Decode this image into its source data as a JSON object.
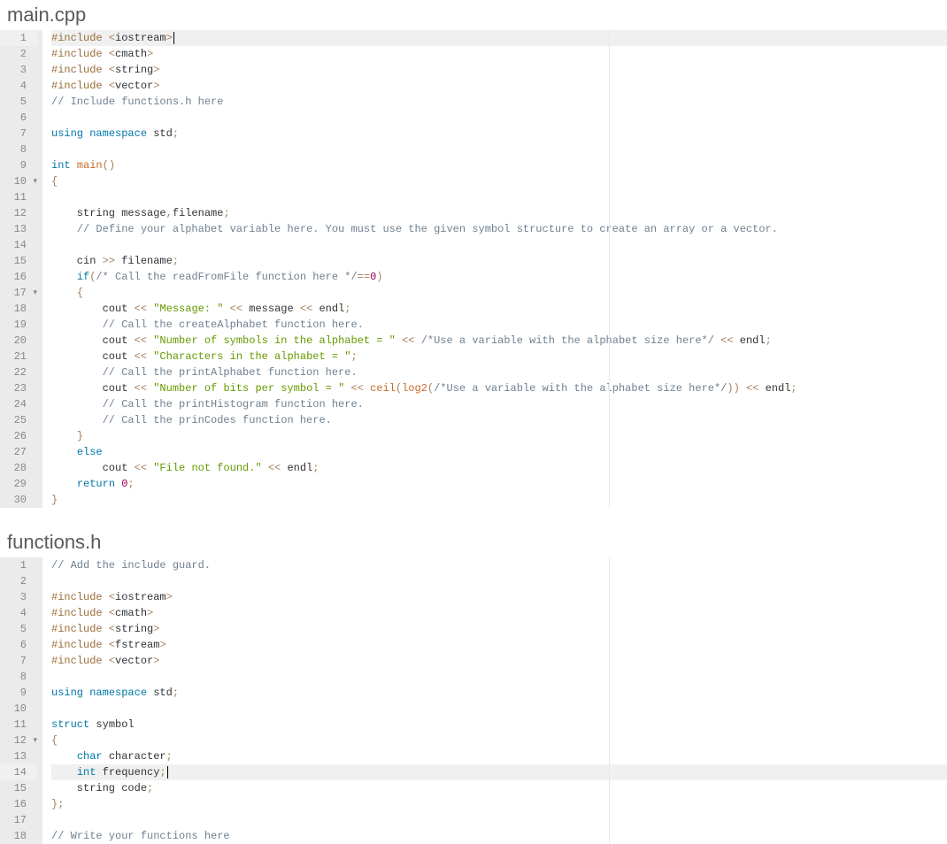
{
  "files": [
    {
      "title": "main.cpp",
      "highlight": 1,
      "cursor_line": 1,
      "lines": [
        {
          "n": 1,
          "fold": "",
          "tokens": [
            [
              "pre",
              "#include "
            ],
            [
              "op",
              "<"
            ],
            [
              "id",
              "iostream"
            ],
            [
              "op",
              ">"
            ]
          ]
        },
        {
          "n": 2,
          "fold": "",
          "tokens": [
            [
              "pre",
              "#include "
            ],
            [
              "op",
              "<"
            ],
            [
              "id",
              "cmath"
            ],
            [
              "op",
              ">"
            ]
          ]
        },
        {
          "n": 3,
          "fold": "",
          "tokens": [
            [
              "pre",
              "#include "
            ],
            [
              "op",
              "<"
            ],
            [
              "id",
              "string"
            ],
            [
              "op",
              ">"
            ]
          ]
        },
        {
          "n": 4,
          "fold": "",
          "tokens": [
            [
              "pre",
              "#include "
            ],
            [
              "op",
              "<"
            ],
            [
              "id",
              "vector"
            ],
            [
              "op",
              ">"
            ]
          ]
        },
        {
          "n": 5,
          "fold": "",
          "tokens": [
            [
              "cmt",
              "// Include functions.h here"
            ]
          ]
        },
        {
          "n": 6,
          "fold": "",
          "tokens": []
        },
        {
          "n": 7,
          "fold": "",
          "tokens": [
            [
              "kw",
              "using"
            ],
            [
              "id",
              " "
            ],
            [
              "kw",
              "namespace"
            ],
            [
              "id",
              " std"
            ],
            [
              "op",
              ";"
            ]
          ]
        },
        {
          "n": 8,
          "fold": "",
          "tokens": []
        },
        {
          "n": 9,
          "fold": "",
          "tokens": [
            [
              "type",
              "int"
            ],
            [
              "id",
              " "
            ],
            [
              "fn",
              "main"
            ],
            [
              "op",
              "()"
            ]
          ]
        },
        {
          "n": 10,
          "fold": "▾",
          "tokens": [
            [
              "op",
              "{"
            ]
          ]
        },
        {
          "n": 11,
          "fold": "",
          "tokens": []
        },
        {
          "n": 12,
          "fold": "",
          "tokens": [
            [
              "id",
              "    string message"
            ],
            [
              "op",
              ","
            ],
            [
              "id",
              "filename"
            ],
            [
              "op",
              ";"
            ]
          ]
        },
        {
          "n": 13,
          "fold": "",
          "tokens": [
            [
              "id",
              "    "
            ],
            [
              "cmt",
              "// Define your alphabet variable here. You must use the given symbol structure to create an array or a vector."
            ]
          ]
        },
        {
          "n": 14,
          "fold": "",
          "tokens": []
        },
        {
          "n": 15,
          "fold": "",
          "tokens": [
            [
              "id",
              "    cin "
            ],
            [
              "op",
              ">>"
            ],
            [
              "id",
              " filename"
            ],
            [
              "op",
              ";"
            ]
          ]
        },
        {
          "n": 16,
          "fold": "",
          "tokens": [
            [
              "id",
              "    "
            ],
            [
              "kw",
              "if"
            ],
            [
              "op",
              "("
            ],
            [
              "cmt",
              "/* Call the readFromFile function here */"
            ],
            [
              "op",
              "=="
            ],
            [
              "num",
              "0"
            ],
            [
              "op",
              ")"
            ]
          ]
        },
        {
          "n": 17,
          "fold": "▾",
          "tokens": [
            [
              "id",
              "    "
            ],
            [
              "op",
              "{"
            ]
          ]
        },
        {
          "n": 18,
          "fold": "",
          "tokens": [
            [
              "id",
              "        cout "
            ],
            [
              "op",
              "<<"
            ],
            [
              "id",
              " "
            ],
            [
              "str",
              "\"Message: \""
            ],
            [
              "id",
              " "
            ],
            [
              "op",
              "<<"
            ],
            [
              "id",
              " message "
            ],
            [
              "op",
              "<<"
            ],
            [
              "id",
              " endl"
            ],
            [
              "op",
              ";"
            ]
          ]
        },
        {
          "n": 19,
          "fold": "",
          "tokens": [
            [
              "id",
              "        "
            ],
            [
              "cmt",
              "// Call the createAlphabet function here."
            ]
          ]
        },
        {
          "n": 20,
          "fold": "",
          "tokens": [
            [
              "id",
              "        cout "
            ],
            [
              "op",
              "<<"
            ],
            [
              "id",
              " "
            ],
            [
              "str",
              "\"Number of symbols in the alphabet = \""
            ],
            [
              "id",
              " "
            ],
            [
              "op",
              "<<"
            ],
            [
              "id",
              " "
            ],
            [
              "cmt",
              "/*Use a variable with the alphabet size here*/"
            ],
            [
              "id",
              " "
            ],
            [
              "op",
              "<<"
            ],
            [
              "id",
              " endl"
            ],
            [
              "op",
              ";"
            ]
          ]
        },
        {
          "n": 21,
          "fold": "",
          "tokens": [
            [
              "id",
              "        cout "
            ],
            [
              "op",
              "<<"
            ],
            [
              "id",
              " "
            ],
            [
              "str",
              "\"Characters in the alphabet = \""
            ],
            [
              "op",
              ";"
            ]
          ]
        },
        {
          "n": 22,
          "fold": "",
          "tokens": [
            [
              "id",
              "        "
            ],
            [
              "cmt",
              "// Call the printAlphabet function here."
            ]
          ]
        },
        {
          "n": 23,
          "fold": "",
          "tokens": [
            [
              "id",
              "        cout "
            ],
            [
              "op",
              "<<"
            ],
            [
              "id",
              " "
            ],
            [
              "str",
              "\"Number of bits per symbol = \""
            ],
            [
              "id",
              " "
            ],
            [
              "op",
              "<<"
            ],
            [
              "id",
              " "
            ],
            [
              "fn",
              "ceil"
            ],
            [
              "op",
              "("
            ],
            [
              "fn",
              "log2"
            ],
            [
              "op",
              "("
            ],
            [
              "cmt",
              "/*Use a variable with the alphabet size here*/"
            ],
            [
              "op",
              "))"
            ],
            [
              "id",
              " "
            ],
            [
              "op",
              "<<"
            ],
            [
              "id",
              " endl"
            ],
            [
              "op",
              ";"
            ]
          ]
        },
        {
          "n": 24,
          "fold": "",
          "tokens": [
            [
              "id",
              "        "
            ],
            [
              "cmt",
              "// Call the printHistogram function here."
            ]
          ]
        },
        {
          "n": 25,
          "fold": "",
          "tokens": [
            [
              "id",
              "        "
            ],
            [
              "cmt",
              "// Call the prinCodes function here."
            ]
          ]
        },
        {
          "n": 26,
          "fold": "",
          "tokens": [
            [
              "id",
              "    "
            ],
            [
              "op",
              "}"
            ]
          ]
        },
        {
          "n": 27,
          "fold": "",
          "tokens": [
            [
              "id",
              "    "
            ],
            [
              "kw",
              "else"
            ]
          ]
        },
        {
          "n": 28,
          "fold": "",
          "tokens": [
            [
              "id",
              "        cout "
            ],
            [
              "op",
              "<<"
            ],
            [
              "id",
              " "
            ],
            [
              "str",
              "\"File not found.\""
            ],
            [
              "id",
              " "
            ],
            [
              "op",
              "<<"
            ],
            [
              "id",
              " endl"
            ],
            [
              "op",
              ";"
            ]
          ]
        },
        {
          "n": 29,
          "fold": "",
          "tokens": [
            [
              "id",
              "    "
            ],
            [
              "kw",
              "return"
            ],
            [
              "id",
              " "
            ],
            [
              "num",
              "0"
            ],
            [
              "op",
              ";"
            ]
          ]
        },
        {
          "n": 30,
          "fold": "",
          "tokens": [
            [
              "op",
              "}"
            ]
          ]
        }
      ]
    },
    {
      "title": "functions.h",
      "highlight": 14,
      "cursor_line": 14,
      "lines": [
        {
          "n": 1,
          "fold": "",
          "tokens": [
            [
              "cmt",
              "// Add the include guard."
            ]
          ]
        },
        {
          "n": 2,
          "fold": "",
          "tokens": []
        },
        {
          "n": 3,
          "fold": "",
          "tokens": [
            [
              "pre",
              "#include "
            ],
            [
              "op",
              "<"
            ],
            [
              "id",
              "iostream"
            ],
            [
              "op",
              ">"
            ]
          ]
        },
        {
          "n": 4,
          "fold": "",
          "tokens": [
            [
              "pre",
              "#include "
            ],
            [
              "op",
              "<"
            ],
            [
              "id",
              "cmath"
            ],
            [
              "op",
              ">"
            ]
          ]
        },
        {
          "n": 5,
          "fold": "",
          "tokens": [
            [
              "pre",
              "#include "
            ],
            [
              "op",
              "<"
            ],
            [
              "id",
              "string"
            ],
            [
              "op",
              ">"
            ]
          ]
        },
        {
          "n": 6,
          "fold": "",
          "tokens": [
            [
              "pre",
              "#include "
            ],
            [
              "op",
              "<"
            ],
            [
              "id",
              "fstream"
            ],
            [
              "op",
              ">"
            ]
          ]
        },
        {
          "n": 7,
          "fold": "",
          "tokens": [
            [
              "pre",
              "#include "
            ],
            [
              "op",
              "<"
            ],
            [
              "id",
              "vector"
            ],
            [
              "op",
              ">"
            ]
          ]
        },
        {
          "n": 8,
          "fold": "",
          "tokens": []
        },
        {
          "n": 9,
          "fold": "",
          "tokens": [
            [
              "kw",
              "using"
            ],
            [
              "id",
              " "
            ],
            [
              "kw",
              "namespace"
            ],
            [
              "id",
              " std"
            ],
            [
              "op",
              ";"
            ]
          ]
        },
        {
          "n": 10,
          "fold": "",
          "tokens": []
        },
        {
          "n": 11,
          "fold": "",
          "tokens": [
            [
              "kw",
              "struct"
            ],
            [
              "id",
              " symbol"
            ]
          ]
        },
        {
          "n": 12,
          "fold": "▾",
          "tokens": [
            [
              "op",
              "{"
            ]
          ]
        },
        {
          "n": 13,
          "fold": "",
          "tokens": [
            [
              "id",
              "    "
            ],
            [
              "type",
              "char"
            ],
            [
              "id",
              " character"
            ],
            [
              "op",
              ";"
            ]
          ]
        },
        {
          "n": 14,
          "fold": "",
          "tokens": [
            [
              "id",
              "    "
            ],
            [
              "type",
              "int"
            ],
            [
              "id",
              " frequency"
            ],
            [
              "op",
              ";"
            ]
          ]
        },
        {
          "n": 15,
          "fold": "",
          "tokens": [
            [
              "id",
              "    string code"
            ],
            [
              "op",
              ";"
            ]
          ]
        },
        {
          "n": 16,
          "fold": "",
          "tokens": [
            [
              "op",
              "};"
            ]
          ]
        },
        {
          "n": 17,
          "fold": "",
          "tokens": []
        },
        {
          "n": 18,
          "fold": "",
          "tokens": [
            [
              "cmt",
              "// Write your functions here"
            ]
          ]
        }
      ]
    }
  ]
}
